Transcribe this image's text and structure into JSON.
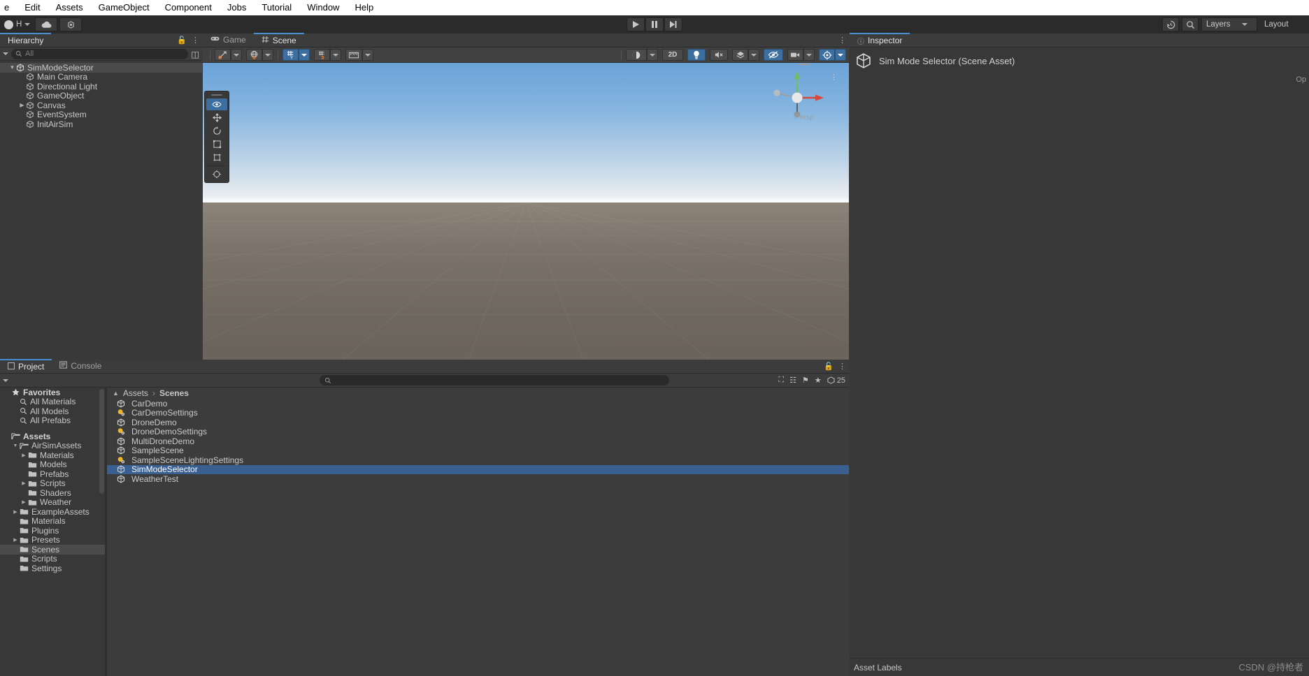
{
  "menubar": {
    "items": [
      "e",
      "Edit",
      "Assets",
      "GameObject",
      "Component",
      "Jobs",
      "Tutorial",
      "Window",
      "Help"
    ]
  },
  "toolbar": {
    "account_label": "H",
    "cloud_icon": "cloud-icon",
    "collab_icon": "collab-icon",
    "play_icon": "▶",
    "pause_icon": "❚❚",
    "step_icon": "▶❙",
    "history_icon": "history-icon",
    "search_icon": "search-icon",
    "layers_label": "Layers",
    "layout_label": "Layout"
  },
  "hierarchy": {
    "tab_label": "Hierarchy",
    "search_placeholder": "All",
    "tree": [
      {
        "label": "SimModeSelector",
        "depth": 0,
        "icon": "unity-scene-icon",
        "expanded": true,
        "selected": true
      },
      {
        "label": "Main Camera",
        "depth": 1,
        "icon": "gameobject-icon",
        "expanded": null,
        "selected": false
      },
      {
        "label": "Directional Light",
        "depth": 1,
        "icon": "gameobject-icon",
        "expanded": null,
        "selected": false
      },
      {
        "label": "GameObject",
        "depth": 1,
        "icon": "gameobject-icon",
        "expanded": null,
        "selected": false
      },
      {
        "label": "Canvas",
        "depth": 1,
        "icon": "gameobject-icon",
        "expanded": false,
        "selected": false
      },
      {
        "label": "EventSystem",
        "depth": 1,
        "icon": "gameobject-icon",
        "expanded": null,
        "selected": false
      },
      {
        "label": "InitAirSim",
        "depth": 1,
        "icon": "gameobject-icon",
        "expanded": null,
        "selected": false
      }
    ]
  },
  "scene": {
    "tabs": [
      {
        "label": "Scene",
        "icon": "scene-grid-icon",
        "active": true
      },
      {
        "label": "Game",
        "icon": "gamepad-icon",
        "active": false
      }
    ],
    "toolbar": {
      "pivot_icon": "pivot-icon",
      "handle_icon": "global-handle-icon",
      "grid_icon": "grid-y-icon",
      "snap_icon": "snap-increment-icon",
      "ruler_icon": "ruler-icon",
      "shading_icon": "shading-mode-icon",
      "mode_2d_label": "2D",
      "light_icon": "lighting-icon",
      "audio_icon": "audio-mute-icon",
      "fx_icon": "effects-icon",
      "hidden_icon": "scene-visibility-icon",
      "camera_icon": "camera-icon",
      "gizmos_icon": "gizmos-icon"
    },
    "tool_palette": [
      "view-hand-icon",
      "move-icon",
      "rotate-icon",
      "scale-icon",
      "rect-transform-icon",
      "transform-icon"
    ],
    "gizmo_persp_label": "Persp"
  },
  "inspector": {
    "tab_label": "Inspector",
    "asset_title": "Sim Mode Selector (Scene Asset)",
    "open_label": "Op",
    "asset_labels_label": "Asset Labels",
    "watermark": "CSDN @持枪者"
  },
  "project": {
    "tabs": [
      {
        "label": "Project",
        "icon": "project-icon",
        "active": true
      },
      {
        "label": "Console",
        "icon": "console-icon",
        "active": false
      }
    ],
    "search_placeholder": "",
    "item_count": "25",
    "breadcrumb": [
      "Assets",
      "Scenes"
    ],
    "tree": [
      {
        "label": "Favorites",
        "depth": 0,
        "type": "star",
        "bold": true,
        "expanded": null,
        "selected": false
      },
      {
        "label": "All Materials",
        "depth": 1,
        "type": "search",
        "bold": false,
        "expanded": null,
        "selected": false
      },
      {
        "label": "All Models",
        "depth": 1,
        "type": "search",
        "bold": false,
        "expanded": null,
        "selected": false
      },
      {
        "label": "All Prefabs",
        "depth": 1,
        "type": "search",
        "bold": false,
        "expanded": null,
        "selected": false
      },
      {
        "label": "",
        "depth": 0,
        "type": "gap",
        "bold": false,
        "expanded": null,
        "selected": false
      },
      {
        "label": "Assets",
        "depth": 0,
        "type": "folder-open",
        "bold": true,
        "expanded": null,
        "selected": false
      },
      {
        "label": "AirSimAssets",
        "depth": 1,
        "type": "folder-open",
        "bold": false,
        "expanded": true,
        "selected": false
      },
      {
        "label": "Materials",
        "depth": 2,
        "type": "folder",
        "bold": false,
        "expanded": false,
        "selected": false
      },
      {
        "label": "Models",
        "depth": 2,
        "type": "folder",
        "bold": false,
        "expanded": null,
        "selected": false
      },
      {
        "label": "Prefabs",
        "depth": 2,
        "type": "folder",
        "bold": false,
        "expanded": null,
        "selected": false
      },
      {
        "label": "Scripts",
        "depth": 2,
        "type": "folder",
        "bold": false,
        "expanded": false,
        "selected": false
      },
      {
        "label": "Shaders",
        "depth": 2,
        "type": "folder",
        "bold": false,
        "expanded": null,
        "selected": false
      },
      {
        "label": "Weather",
        "depth": 2,
        "type": "folder",
        "bold": false,
        "expanded": false,
        "selected": false
      },
      {
        "label": "ExampleAssets",
        "depth": 1,
        "type": "folder",
        "bold": false,
        "expanded": false,
        "selected": false
      },
      {
        "label": "Materials",
        "depth": 1,
        "type": "folder",
        "bold": false,
        "expanded": null,
        "selected": false
      },
      {
        "label": "Plugins",
        "depth": 1,
        "type": "folder",
        "bold": false,
        "expanded": null,
        "selected": false
      },
      {
        "label": "Presets",
        "depth": 1,
        "type": "folder",
        "bold": false,
        "expanded": false,
        "selected": false
      },
      {
        "label": "Scenes",
        "depth": 1,
        "type": "folder",
        "bold": false,
        "expanded": null,
        "selected": true
      },
      {
        "label": "Scripts",
        "depth": 1,
        "type": "folder",
        "bold": false,
        "expanded": null,
        "selected": false
      },
      {
        "label": "Settings",
        "depth": 1,
        "type": "folder",
        "bold": false,
        "expanded": null,
        "selected": false
      }
    ],
    "assets": [
      {
        "label": "CarDemo",
        "icon": "unity-scene-icon",
        "selected": false
      },
      {
        "label": "CarDemoSettings",
        "icon": "lighting-settings-icon",
        "selected": false
      },
      {
        "label": "DroneDemo",
        "icon": "unity-scene-icon",
        "selected": false
      },
      {
        "label": "DroneDemoSettings",
        "icon": "lighting-settings-icon",
        "selected": false
      },
      {
        "label": "MultiDroneDemo",
        "icon": "unity-scene-icon",
        "selected": false
      },
      {
        "label": "SampleScene",
        "icon": "unity-scene-icon",
        "selected": false
      },
      {
        "label": "SampleSceneLightingSettings",
        "icon": "lighting-settings-icon",
        "selected": false
      },
      {
        "label": "SimModeSelector",
        "icon": "unity-scene-icon",
        "selected": true
      },
      {
        "label": "WeatherTest",
        "icon": "unity-scene-icon",
        "selected": false
      }
    ]
  },
  "colors": {
    "accent_blue": "#3c6e9f",
    "selection_blue": "#3a5f91",
    "panel_bg": "#383838",
    "toolbar_bg": "#2b2b2b"
  }
}
